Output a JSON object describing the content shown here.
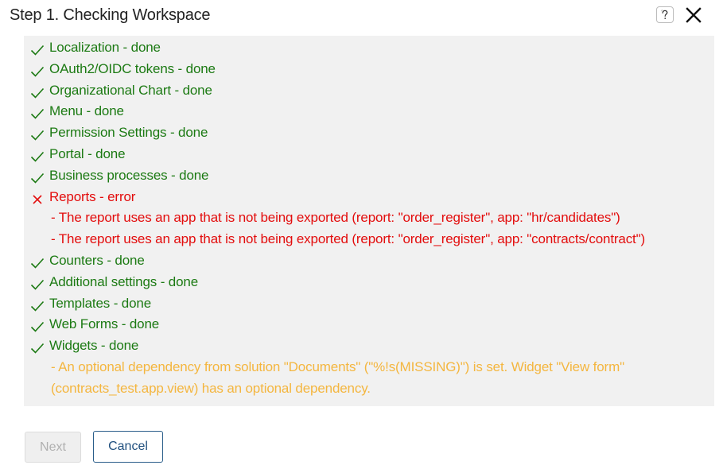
{
  "dialog": {
    "title": "Step 1. Checking Workspace",
    "help_icon": "question-icon",
    "close_icon": "close-icon"
  },
  "colors": {
    "done": "#1c7a13",
    "error": "#e30d0d",
    "warning": "#f4b63f",
    "log_background": "#f1f1f1",
    "primary_border": "#2b5e8a"
  },
  "log": {
    "items": [
      {
        "status": "done",
        "text": "Localization - done"
      },
      {
        "status": "done",
        "text": "OAuth2/OIDC tokens - done"
      },
      {
        "status": "done",
        "text": "Organizational Chart - done"
      },
      {
        "status": "done",
        "text": "Menu - done"
      },
      {
        "status": "done",
        "text": "Permission Settings - done"
      },
      {
        "status": "done",
        "text": "Portal - done"
      },
      {
        "status": "done",
        "text": "Business processes - done"
      },
      {
        "status": "error",
        "text": "Reports - error"
      },
      {
        "status": "error-detail",
        "text": "- The report uses an app that is not being exported (report: \"order_register\", app: \"hr/candidates\")"
      },
      {
        "status": "error-detail",
        "text": "- The report uses an app that is not being exported (report: \"order_register\", app: \"contracts/contract\")"
      },
      {
        "status": "done",
        "text": "Counters - done"
      },
      {
        "status": "done",
        "text": "Additional settings - done"
      },
      {
        "status": "done",
        "text": "Templates - done"
      },
      {
        "status": "done",
        "text": "Web Forms - done"
      },
      {
        "status": "done",
        "text": "Widgets - done"
      },
      {
        "status": "warning-detail",
        "text": "- An optional dependency from solution \"Documents\" (\"%!s(MISSING)\") is set. Widget \"View form\" (contracts_test.app.view) has an optional dependency."
      }
    ]
  },
  "footer": {
    "next_label": "Next",
    "cancel_label": "Cancel"
  }
}
